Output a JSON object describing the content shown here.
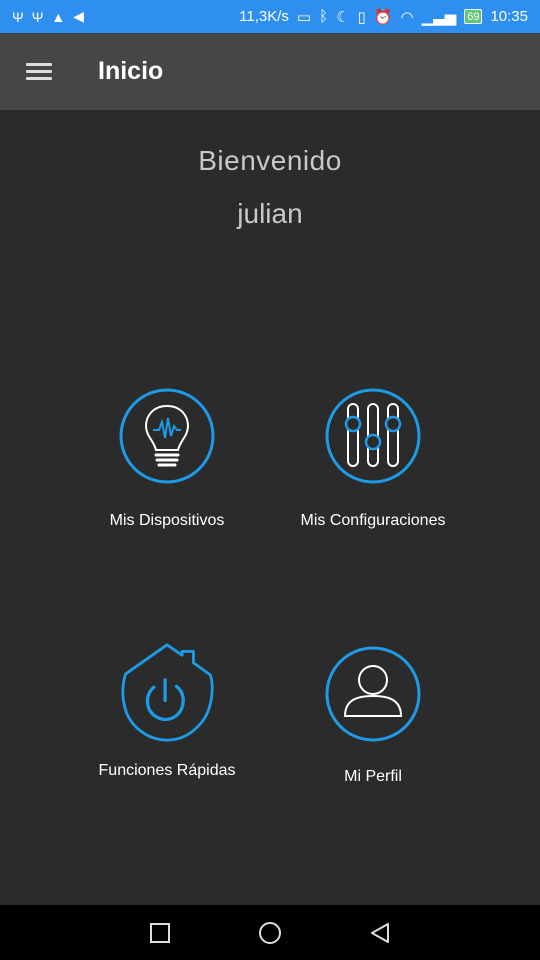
{
  "status_bar": {
    "speed": "11,3K/s",
    "battery": "69",
    "time": "10:35"
  },
  "app_bar": {
    "title": "Inicio"
  },
  "welcome": {
    "greeting": "Bienvenido",
    "username": "julian"
  },
  "tiles": [
    {
      "label": "Mis Dispositivos",
      "icon": "lightbulb-icon"
    },
    {
      "label": "Mis Configuraciones",
      "icon": "sliders-icon"
    },
    {
      "label": "Funciones Rápidas",
      "icon": "home-power-icon"
    },
    {
      "label": "Mi Perfil",
      "icon": "user-icon"
    }
  ],
  "colors": {
    "status_bar": "#2f8ff0",
    "app_bar": "#464646",
    "background": "#2b2b2b",
    "accent": "#1e9be6"
  }
}
